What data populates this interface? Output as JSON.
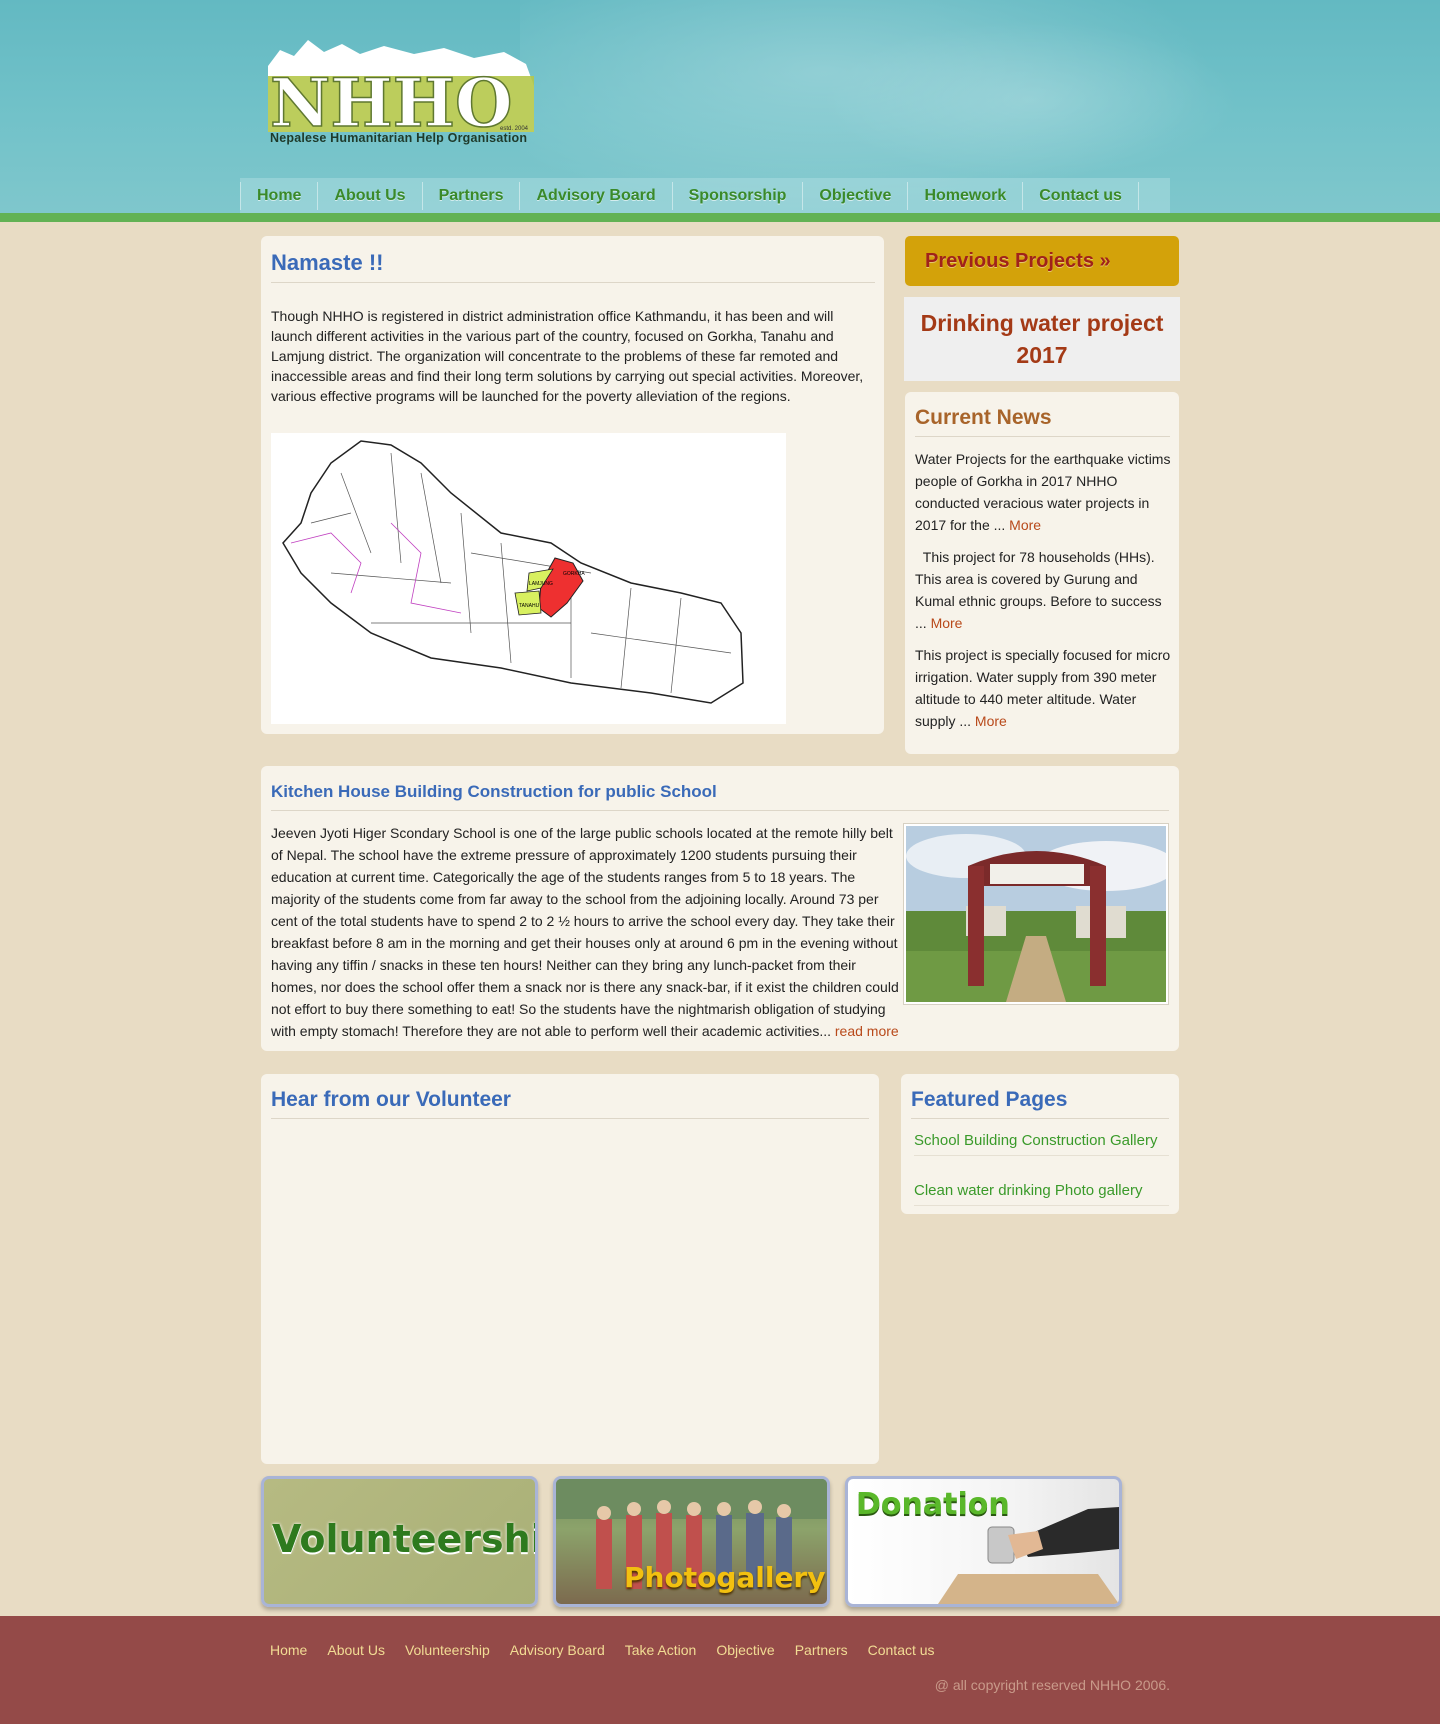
{
  "header": {
    "logo_text": "NHHO",
    "logo_estd": "estd. 2004",
    "logo_subtitle": "Nepalese Humanitarian Help Organisation"
  },
  "nav": [
    {
      "label": "Home"
    },
    {
      "label": "About Us"
    },
    {
      "label": "Partners"
    },
    {
      "label": "Advisory Board"
    },
    {
      "label": "Sponsorship"
    },
    {
      "label": "Objective"
    },
    {
      "label": "Homework"
    },
    {
      "label": "Contact us"
    }
  ],
  "namaste": {
    "title": "Namaste !!",
    "text": "Though NHHO is registered in district administration office Kathmandu, it has been and will launch different activities in the various part of the country, focused on Gorkha, Tanahu and Lamjung district.  The  organization will concentrate to the problems of these far remoted and inaccessible areas and find their long term solutions by carrying out special activities. Moreover, various effective programs will be launched for the poverty alleviation of the regions.",
    "map_labels": {
      "gorkha": "GORKHA",
      "lamjung": "LAMJUNG",
      "tanahu": "TANAHU"
    }
  },
  "sidebar": {
    "previous_projects": "Previous Projects »",
    "drinking_water": "Drinking water project 2017",
    "news_title": "Current News",
    "news": [
      {
        "text": "Water Projects for the earthquake victims people of Gorkha in 2017 NHHO conducted veracious water projects in 2017 for the ... ",
        "more": "More"
      },
      {
        "text": "  This project for 78 households (HHs). This area is covered by Gurung and Kumal ethnic groups. Before to success ... ",
        "more": "More"
      },
      {
        "text": "This project is specially focused for micro irrigation. Water supply from 390 meter altitude to 440 meter altitude. Water supply ... ",
        "more": "More"
      }
    ]
  },
  "kitchen": {
    "title": "Kitchen House Building Construction for public School",
    "text": "Jeeven Jyoti Higer Scondary School is one of the large public schools located at the remote hilly belt of Nepal. The school have the extreme pressure of approximately 1200 students pursuing their education at current time. Categorically the age of the students ranges from 5 to 18 years. The majority of the students come from far away to the school from the adjoining locally. Around 73 per cent of the total students have to spend 2 to 2 ½ hours to arrive the school every day. They take their breakfast before 8 am in the morning and get their houses only at around 6 pm in the evening without having any tiffin / snacks in these ten hours! Neither can they bring any lunch-packet from their homes, nor does the school offer them a snack nor is there any snack-bar, if it exist the children could not effort to buy there something to eat! So the students have the nightmarish obligation of studying with empty stomach! Therefore they are not able to perform well their academic activities... ",
    "read_more": "read more"
  },
  "volunteer": {
    "title": "Hear from our Volunteer"
  },
  "featured": {
    "title": "Featured Pages",
    "links": [
      {
        "label": "School Building Construction Gallery"
      },
      {
        "label": "Clean water drinking Photo gallery"
      }
    ]
  },
  "banners": {
    "volunteership": "Volunteership",
    "photogallery": "Photogallery",
    "donation": "Donation"
  },
  "footer": {
    "links": [
      {
        "label": "Home"
      },
      {
        "label": "About Us"
      },
      {
        "label": "Volunteership"
      },
      {
        "label": "Advisory Board"
      },
      {
        "label": "Take Action"
      },
      {
        "label": "Objective"
      },
      {
        "label": "Partners"
      },
      {
        "label": "Contact us"
      }
    ],
    "copyright": "@ all copyright reserved NHHO 2006."
  },
  "colors": {
    "header_teal": "#6ebfc6",
    "green_band": "#62b254",
    "page_bg": "#e8dcc4",
    "title_blue": "#3a6ab8",
    "link_orange": "#b8491a",
    "gold_button": "#d3a20a",
    "footer_bg": "#944a48"
  }
}
